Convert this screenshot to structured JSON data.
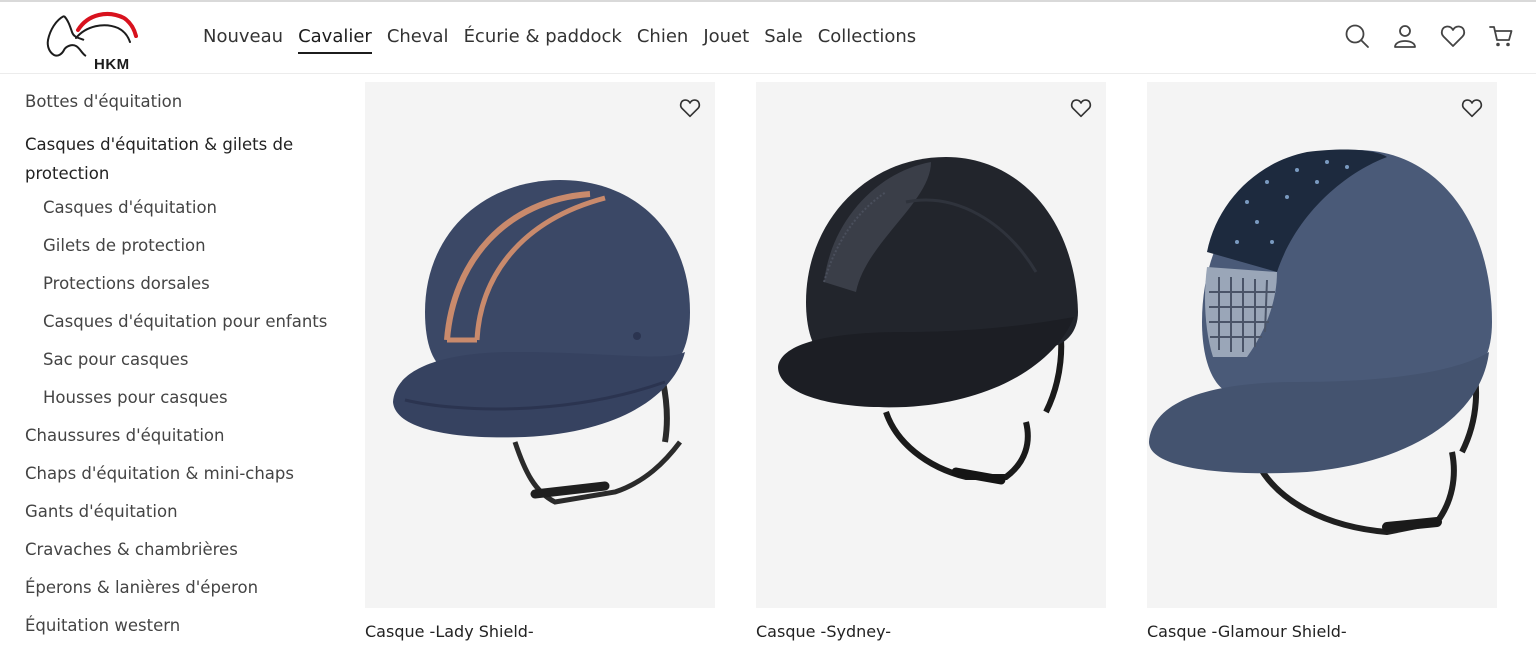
{
  "brand": {
    "logo_text": "HKM",
    "accent_color": "#d8121e"
  },
  "nav": {
    "items": [
      {
        "label": "Nouveau",
        "active": false
      },
      {
        "label": "Cavalier",
        "active": true
      },
      {
        "label": "Cheval",
        "active": false
      },
      {
        "label": "Écurie & paddock",
        "active": false
      },
      {
        "label": "Chien",
        "active": false
      },
      {
        "label": "Jouet",
        "active": false
      },
      {
        "label": "Sale",
        "active": false
      },
      {
        "label": "Collections",
        "active": false
      }
    ]
  },
  "header_icons": [
    "search-icon",
    "user-icon",
    "heart-icon",
    "cart-icon"
  ],
  "sidebar": {
    "items": [
      {
        "label": "Bottes d'équitation",
        "level": 0
      },
      {
        "label": "Casques d'équitation & gilets de protection",
        "level": 0,
        "active": true
      },
      {
        "label": "Casques d'équitation",
        "level": 1
      },
      {
        "label": "Gilets de protection",
        "level": 1
      },
      {
        "label": "Protections dorsales",
        "level": 1
      },
      {
        "label": "Casques d'équitation pour enfants",
        "level": 1
      },
      {
        "label": "Sac pour casques",
        "level": 1
      },
      {
        "label": "Housses pour casques",
        "level": 1
      },
      {
        "label": "Chaussures d'équitation",
        "level": 0
      },
      {
        "label": "Chaps d'équitation & mini-chaps",
        "level": 0
      },
      {
        "label": "Gants d'équitation",
        "level": 0
      },
      {
        "label": "Cravaches & chambrières",
        "level": 0
      },
      {
        "label": "Éperons & lanières d'éperon",
        "level": 0
      },
      {
        "label": "Équitation western",
        "level": 0
      }
    ]
  },
  "products": [
    {
      "name": "Casque -Lady Shield-",
      "color": "#3b4866",
      "accent": "#c98a6c"
    },
    {
      "name": "Casque -Sydney-",
      "color": "#22252c",
      "accent": "#3a3e48"
    },
    {
      "name": "Casque -Glamour Shield-",
      "color": "#4a5a78",
      "accent": "#9aa6b8"
    }
  ]
}
